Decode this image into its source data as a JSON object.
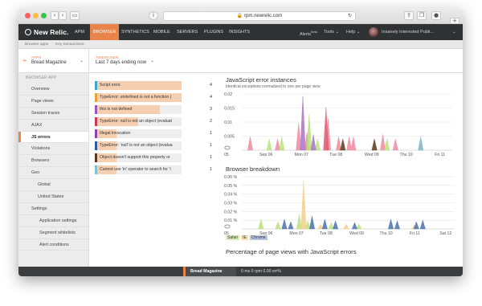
{
  "browser": {
    "url": "rpm.newrelic.com",
    "colors": {
      "close": "#fc605c",
      "minimize": "#fdbc40",
      "zoom": "#34c84a"
    }
  },
  "nav": {
    "logo": "New Relic.",
    "items": [
      "APM",
      "BROWSER",
      "SYNTHETICS",
      "MOBILE",
      "SERVERS",
      "PLUGINS",
      "INSIGHTS"
    ],
    "active_index": 1,
    "alerts_label": "Alerts",
    "alerts_badge": "Beta",
    "tools_label": "Tools",
    "help_label": "Help",
    "user_name": "Insanely Interested Publi...",
    "accent": "#e8834a"
  },
  "subnav": {
    "browser_apps": "Browser apps",
    "key_transactions": "Key transactions"
  },
  "appbar": {
    "apps_label": "APPS",
    "app_value": "Bread Magazine",
    "timepicker_label": "TIMEPICKER",
    "time_value": "Last 7 days ending now"
  },
  "sidebar": {
    "heading": "BROWSER APP",
    "items": [
      {
        "label": "Overview",
        "level": 1
      },
      {
        "label": "Page views",
        "level": 1
      },
      {
        "label": "Session traces",
        "level": 1
      },
      {
        "label": "AJAX",
        "level": 1
      },
      {
        "label": "JS errors",
        "level": 1
      },
      {
        "label": "Violations",
        "level": 1
      },
      {
        "label": "Browsers",
        "level": 1
      },
      {
        "label": "Geo",
        "level": 1
      },
      {
        "label": "Global",
        "level": 2
      },
      {
        "label": "United States",
        "level": 2
      },
      {
        "label": "Settings",
        "level": 1
      },
      {
        "label": "Application settings",
        "level": 3
      },
      {
        "label": "Segment whitelists",
        "level": 3
      },
      {
        "label": "Alert conditions",
        "level": 3
      }
    ],
    "active_index": 4
  },
  "errors": [
    {
      "text": "Script error.",
      "count": "4",
      "color": "#3aa9c9",
      "fill": 1.0
    },
    {
      "text": "TypeError: undefined is not a function (",
      "count": "4",
      "color": "#e8a33d",
      "fill": 1.0
    },
    {
      "text": "this is not defined",
      "count": "3",
      "color": "#9b59b6",
      "fill": 0.75
    },
    {
      "text": "TypeError: null is not an object (evaluat",
      "count": "2",
      "color": "#c93a5b",
      "fill": 0.5
    },
    {
      "text": "Illegal invocation",
      "count": "1",
      "color": "#8e44ad",
      "fill": 0.25
    },
    {
      "text": "TypeError: 'null' is not an object (evalua",
      "count": "1",
      "color": "#2c5d9e",
      "fill": 0.25
    },
    {
      "text": "Object doesn't support this property or",
      "count": "1",
      "color": "#5a3a1a",
      "fill": 0.25
    },
    {
      "text": "Cannot use 'in' operator to search for 'i",
      "count": "1",
      "color": "#7fc4d4",
      "fill": 0.25
    }
  ],
  "chart_data": [
    {
      "type": "area",
      "title": "JavaScript error instances",
      "subtitle": "Identical exceptions normalized to one per page view",
      "ylim": [
        0,
        0.025
      ],
      "y_ticks": [
        "0.02",
        "0.015",
        "0.01",
        "0.005"
      ],
      "x_ticks": [
        "05",
        "Sep 06",
        "Mon 07",
        "Tue 08",
        "Wed 09",
        "Thu 10",
        "Fri 11"
      ],
      "grid": true,
      "series": [
        {
          "color": "#f08aa0",
          "peaks": [
            [
              0.04,
              0.006
            ],
            [
              0.17,
              0.005
            ],
            [
              0.27,
              0.012
            ],
            [
              0.31,
              0.008
            ],
            [
              0.41,
              0.014
            ],
            [
              0.46,
              0.006
            ],
            [
              0.51,
              0.006
            ],
            [
              0.53,
              0.006
            ],
            [
              0.67,
              0.007
            ],
            [
              0.73,
              0.005
            ],
            [
              0.85,
              0.005
            ]
          ]
        },
        {
          "color": "#b9e27b",
          "peaks": [
            [
              0.13,
              0.005
            ],
            [
              0.19,
              0.006
            ],
            [
              0.32,
              0.016
            ],
            [
              0.36,
              0.005
            ],
            [
              0.69,
              0.005
            ]
          ]
        },
        {
          "color": "#a974c4",
          "peaks": [
            [
              0.29,
              0.024
            ],
            [
              0.34,
              0.007
            ]
          ]
        },
        {
          "color": "#e05a6f",
          "peaks": [
            [
              0.4,
              0.019
            ]
          ]
        },
        {
          "color": "#5a3a1a",
          "peaks": [
            [
              0.48,
              0.005
            ],
            [
              0.63,
              0.005
            ]
          ]
        },
        {
          "color": "#7ec5d6",
          "peaks": [
            [
              0.85,
              0.006
            ]
          ]
        }
      ]
    },
    {
      "type": "area",
      "title": "Browser breakdown",
      "ylim": [
        0,
        0.065
      ],
      "y_ticks": [
        "0.06 %",
        "0.05 %",
        "0.04 %",
        "0.03 %",
        "0.02 %",
        "0.01 %"
      ],
      "x_ticks": [
        "05",
        "Sep 06",
        "Mon 07",
        "Tue 08",
        "Wed 09",
        "Thu 10",
        "Fri 11",
        "Sat 12"
      ],
      "grid": true,
      "legend": [
        "Safari",
        "IE",
        "Chrome"
      ],
      "series": [
        {
          "name": "Safari",
          "color": "#b9e27b",
          "peaks": [
            [
              0.09,
              0.012
            ],
            [
              0.17,
              0.009
            ],
            [
              0.27,
              0.018
            ],
            [
              0.31,
              0.01
            ],
            [
              0.42,
              0.008
            ],
            [
              0.55,
              0.006
            ]
          ]
        },
        {
          "name": "IE",
          "color": "#f4d08a",
          "peaks": [
            [
              0.29,
              0.06
            ],
            [
              0.37,
              0.006
            ],
            [
              0.49,
              0.006
            ],
            [
              0.81,
              0.005
            ]
          ]
        },
        {
          "name": "Chrome",
          "color": "#4c72b0",
          "peaks": [
            [
              0.2,
              0.012
            ],
            [
              0.23,
              0.009
            ],
            [
              0.33,
              0.016
            ],
            [
              0.39,
              0.012
            ],
            [
              0.44,
              0.01
            ],
            [
              0.53,
              0.008
            ],
            [
              0.7,
              0.012
            ],
            [
              0.73,
              0.01
            ],
            [
              0.82,
              0.009
            ],
            [
              0.85,
              0.011
            ]
          ]
        }
      ]
    }
  ],
  "chart3_title": "Percentage of page views with JavaScript errors",
  "footer": {
    "app": "Bread Magazine",
    "stats": "0 ms   0 rpm   0.00 err%"
  }
}
